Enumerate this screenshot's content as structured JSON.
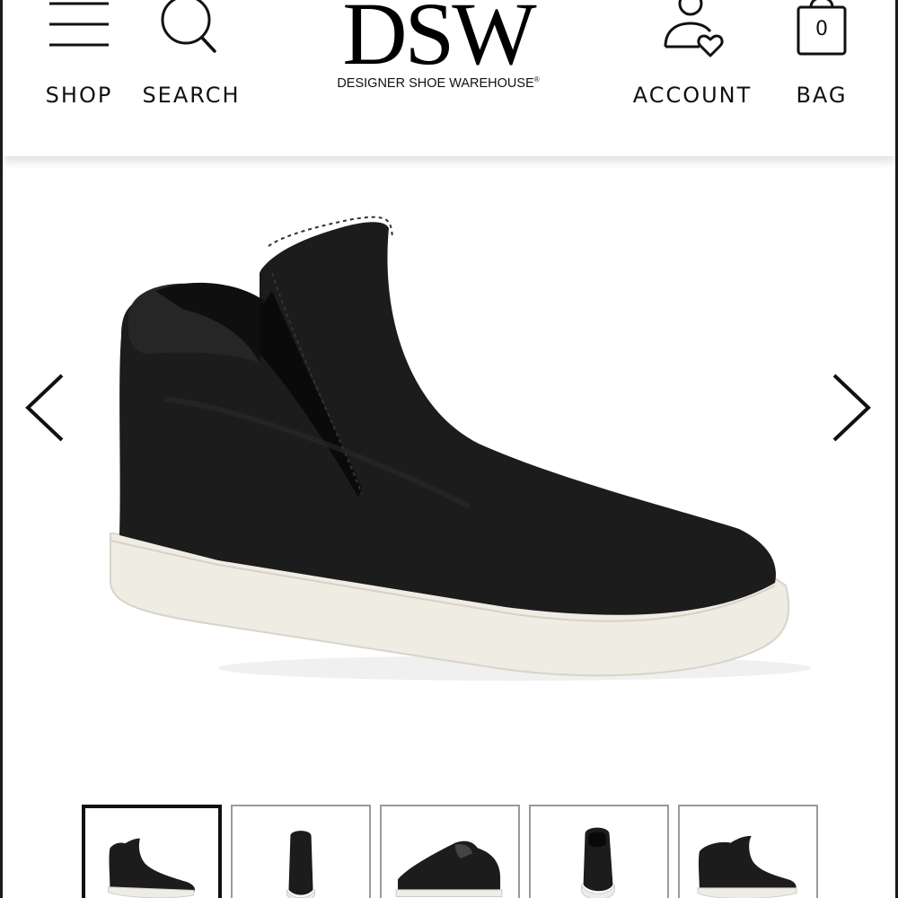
{
  "header": {
    "shop_label": "SHOP",
    "search_label": "SEARCH",
    "account_label": "ACCOUNT",
    "bag_label": "BAG",
    "bag_count": "0",
    "logo_text": "DSW",
    "logo_subtitle": "DESIGNER SHOE WAREHOUSE"
  },
  "icons": {
    "shop": "hamburger-menu-icon",
    "search": "magnifier-icon",
    "account": "person-heart-icon",
    "bag": "shopping-bag-icon",
    "prev": "chevron-left-icon",
    "next": "chevron-right-icon"
  },
  "colors": {
    "text": "#111111",
    "shoe_upper": "#1c1c1c",
    "sole": "#efece4",
    "active_thumb_border": "#111111",
    "thumb_border": "#9a9a9a"
  },
  "gallery": {
    "selected_index": 0,
    "thumbnail_views": [
      "side",
      "back",
      "top-side",
      "front",
      "other-side"
    ]
  }
}
